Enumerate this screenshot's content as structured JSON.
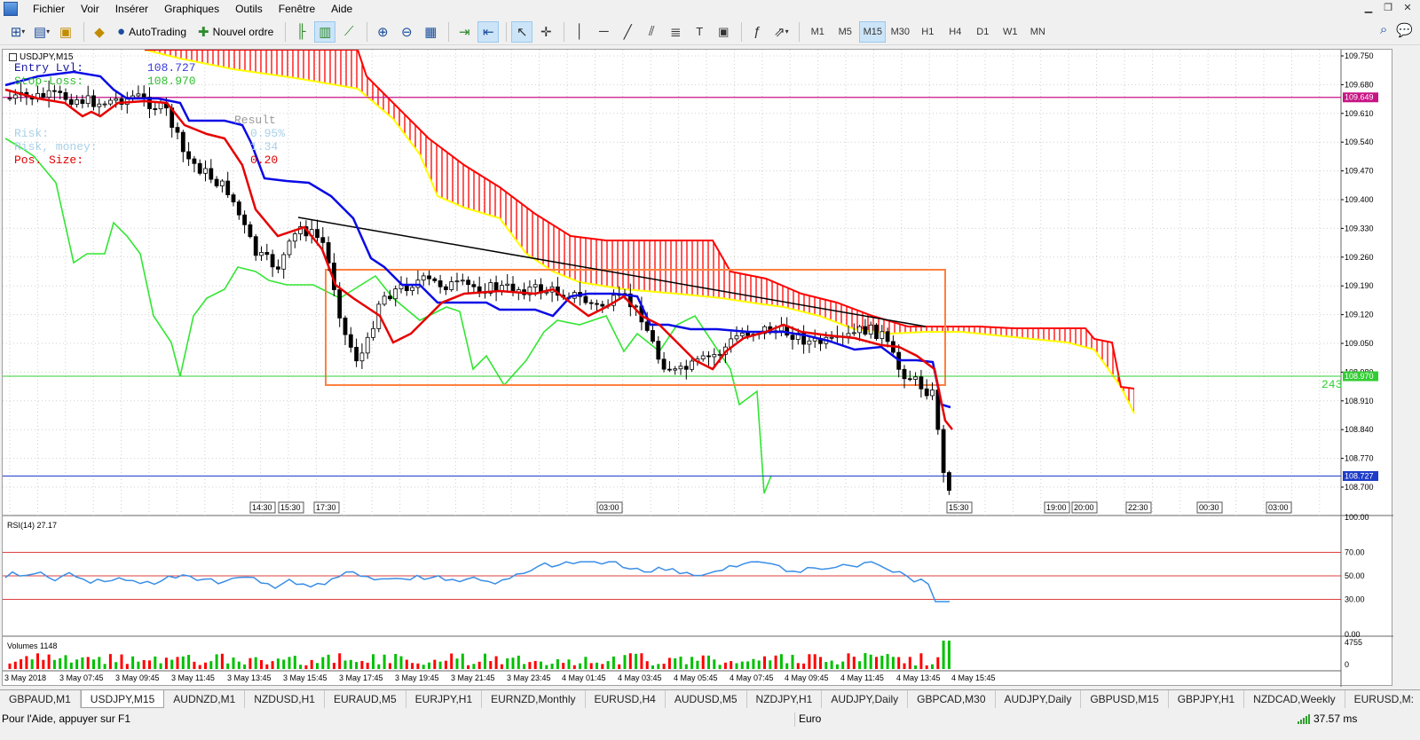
{
  "menu": [
    "Fichier",
    "Voir",
    "Insérer",
    "Graphiques",
    "Outils",
    "Fenêtre",
    "Aide"
  ],
  "toolbar": {
    "autotrading_label": "AutoTrading",
    "new_order_label": "Nouvel ordre",
    "timeframes": [
      "M1",
      "M5",
      "M15",
      "M30",
      "H1",
      "H4",
      "D1",
      "W1",
      "MN"
    ],
    "active_timeframe": "M15"
  },
  "chart": {
    "symbol_title": "USDJPY,M15",
    "position_sizer": {
      "entry_label": "Entry Lvl:",
      "entry_value": "108.727",
      "stop_label": "Stop-Loss:",
      "stop_value": "108.970",
      "result_label": "Result",
      "risk_label": "Risk:",
      "risk_value": "0.95%",
      "risk_money_label": "Risk, money:",
      "risk_money_value": "1.34",
      "pos_size_label": "Pos. Size:",
      "pos_size_value": "0.20"
    },
    "distance_label": "243",
    "price_scale": [
      "109.750",
      "109.680",
      "109.610",
      "109.540",
      "109.470",
      "109.400",
      "109.330",
      "109.260",
      "109.190",
      "109.120",
      "109.050",
      "108.980",
      "108.910",
      "108.840",
      "108.770",
      "108.700"
    ],
    "price_badges": [
      {
        "text": "109.649",
        "color": "#c71585"
      },
      {
        "text": "108.970",
        "color": "#32cd32"
      },
      {
        "text": "108.727",
        "color": "#1e3cc8"
      }
    ],
    "time_badges": [
      "14:30",
      "15:30",
      "17:30",
      "03:00",
      "15:30",
      "19:00",
      "20:00",
      "22:30",
      "00:30",
      "03:00"
    ],
    "rsi_title": "RSI(14) 27.17",
    "rsi_scale": [
      "100.00",
      "70.00",
      "50.00",
      "30.00",
      "0.00"
    ],
    "volume_title": "Volumes 1148",
    "volume_scale": [
      "4755",
      "0"
    ],
    "time_axis": [
      "3 May 2018",
      "3 May 07:45",
      "3 May 09:45",
      "3 May 11:45",
      "3 May 13:45",
      "3 May 15:45",
      "3 May 17:45",
      "3 May 19:45",
      "3 May 21:45",
      "3 May 23:45",
      "4 May 01:45",
      "4 May 03:45",
      "4 May 05:45",
      "4 May 07:45",
      "4 May 09:45",
      "4 May 11:45",
      "4 May 13:45",
      "4 May 15:45"
    ]
  },
  "tabs": [
    "GBPAUD,M1",
    "USDJPY,M15",
    "AUDNZD,M1",
    "NZDUSD,H1",
    "EURAUD,M5",
    "EURJPY,H1",
    "EURNZD,Monthly",
    "EURUSD,H4",
    "AUDUSD,M5",
    "NZDJPY,H1",
    "AUDJPY,Daily",
    "GBPCAD,M30",
    "AUDJPY,Daily",
    "GBPUSD,M15",
    "GBPJPY,H1",
    "NZDCAD,Weekly",
    "EURUSD,M:"
  ],
  "active_tab": "USDJPY,M15",
  "status": {
    "help_text": "Pour l'Aide, appuyer sur F1",
    "profile": "Euro",
    "connection": "37.57 ms"
  },
  "colors": {
    "kijun": "#0a0ae6",
    "tenkan": "#e60000",
    "chikou": "#32e632",
    "cloud_bear": "#ff0000",
    "span_a": "#ffff00",
    "box": "#ff8040",
    "rsi": "#3a8ee6"
  }
}
